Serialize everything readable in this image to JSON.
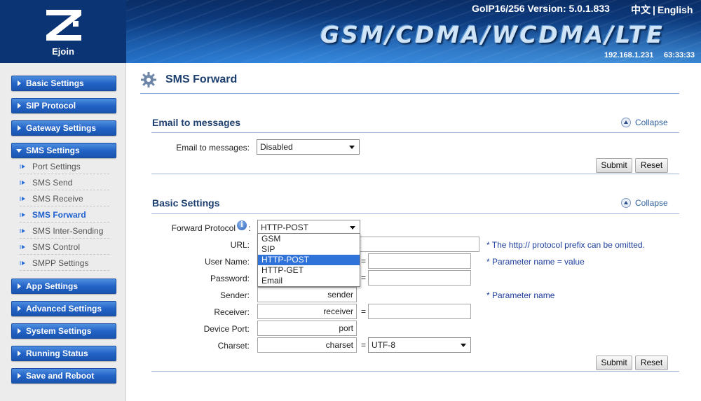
{
  "header": {
    "logo_text": "Ejoin",
    "version": "GoIP16/256 Version: 5.0.1.833",
    "lang_chinese": "中文",
    "lang_sep": "|",
    "lang_english": "English",
    "banner": "GSM/CDMA/WCDMA/LTE",
    "ip": "192.168.1.231",
    "clock": "63:33:33"
  },
  "sidebar": {
    "items": [
      {
        "label": "Basic Settings"
      },
      {
        "label": "SIP Protocol"
      },
      {
        "label": "Gateway Settings"
      },
      {
        "label": "SMS Settings"
      },
      {
        "label": "App Settings"
      },
      {
        "label": "Advanced Settings"
      },
      {
        "label": "System Settings"
      },
      {
        "label": "Running Status"
      },
      {
        "label": "Save and Reboot"
      }
    ],
    "sms_sub": [
      {
        "label": "Port Settings"
      },
      {
        "label": "SMS Send"
      },
      {
        "label": "SMS Receive"
      },
      {
        "label": "SMS Forward"
      },
      {
        "label": "SMS Inter-Sending"
      },
      {
        "label": "SMS Control"
      },
      {
        "label": "SMPP Settings"
      }
    ]
  },
  "main": {
    "title": "SMS Forward",
    "email_section": {
      "title": "Email to messages",
      "collapse": "Collapse",
      "label": "Email to messages:",
      "value": "Disabled",
      "submit": "Submit",
      "reset": "Reset"
    },
    "basic_section": {
      "title": "Basic Settings",
      "collapse": "Collapse",
      "protocol_label": "Forward Protocol",
      "protocol_colon": ":",
      "protocol_value": "HTTP-POST",
      "protocol_options": [
        "GSM",
        "SIP",
        "HTTP-POST",
        "HTTP-GET",
        "Email"
      ],
      "url_label": "URL:",
      "url_hint": "* The http:// protocol prefix can be omitted.",
      "username_label": "User Name:",
      "password_label": "Password:",
      "param_hint": "* Parameter name = value",
      "sender_label": "Sender:",
      "sender_value": "sender",
      "sender_hint": "* Parameter name",
      "receiver_label": "Receiver:",
      "receiver_value": "receiver",
      "device_port_label": "Device Port:",
      "device_port_value": "port",
      "charset_label": "Charset:",
      "charset_value": "charset",
      "charset_select": "UTF-8",
      "eq": "=",
      "submit": "Submit",
      "reset": "Reset"
    }
  }
}
